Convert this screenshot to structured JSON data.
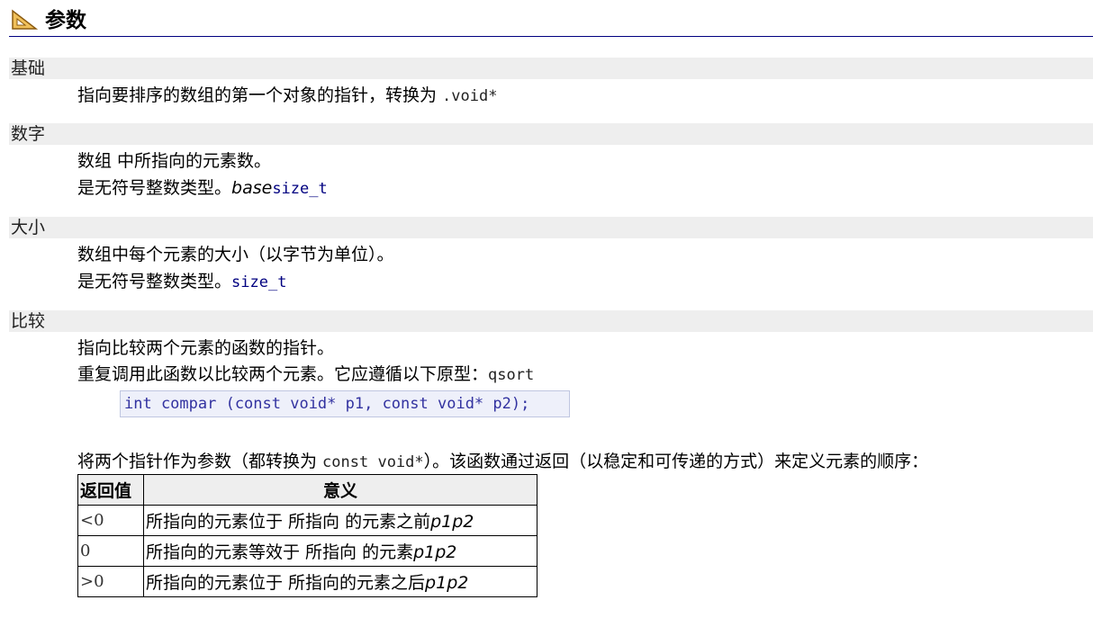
{
  "section": {
    "title": "参数",
    "icon": "set-square-icon"
  },
  "params": [
    {
      "name": "基础",
      "lines": [
        {
          "text": "指向要排序的数组的第一个对象的指针，转换为 ",
          "code": ".void*"
        }
      ]
    },
    {
      "name": "数字",
      "lines": [
        {
          "text": "数组 中所指向的元素数。"
        },
        {
          "text": "是无符号整数类型。",
          "italic": "base",
          "code": "size_t"
        }
      ]
    },
    {
      "name": "大小",
      "lines": [
        {
          "text": "数组中每个元素的大小（以字节为单位）。"
        },
        {
          "text": "是无符号整数类型。",
          "code": "size_t"
        }
      ]
    },
    {
      "name": "比较",
      "lines": [
        {
          "text": "指向比较两个元素的函数的指针。"
        },
        {
          "text": "重复调用此函数以比较两个元素。它应遵循以下原型：",
          "code": "qsort"
        }
      ],
      "prototype": "int compar (const void* p1, const void* p2);",
      "after": {
        "pre": "将两个指针作为参数（都转换为 ",
        "code": "const void*",
        "post": "）。该函数通过返回（以稳定和可传递的方式）来定义元素的顺序："
      }
    }
  ],
  "return_table": {
    "headers": [
      "返回值",
      "意义"
    ],
    "rows": [
      {
        "value": "<0",
        "meaning": "所指向的元素位于 所指向 的元素之前",
        "vars": "p1p2"
      },
      {
        "value": "0",
        "meaning": "所指向的元素等效于 所指向 的元素",
        "vars": "p1p2"
      },
      {
        "value": ">0",
        "meaning": "所指向的元素位于 所指向的元素之后",
        "vars": "p1p2"
      }
    ]
  }
}
